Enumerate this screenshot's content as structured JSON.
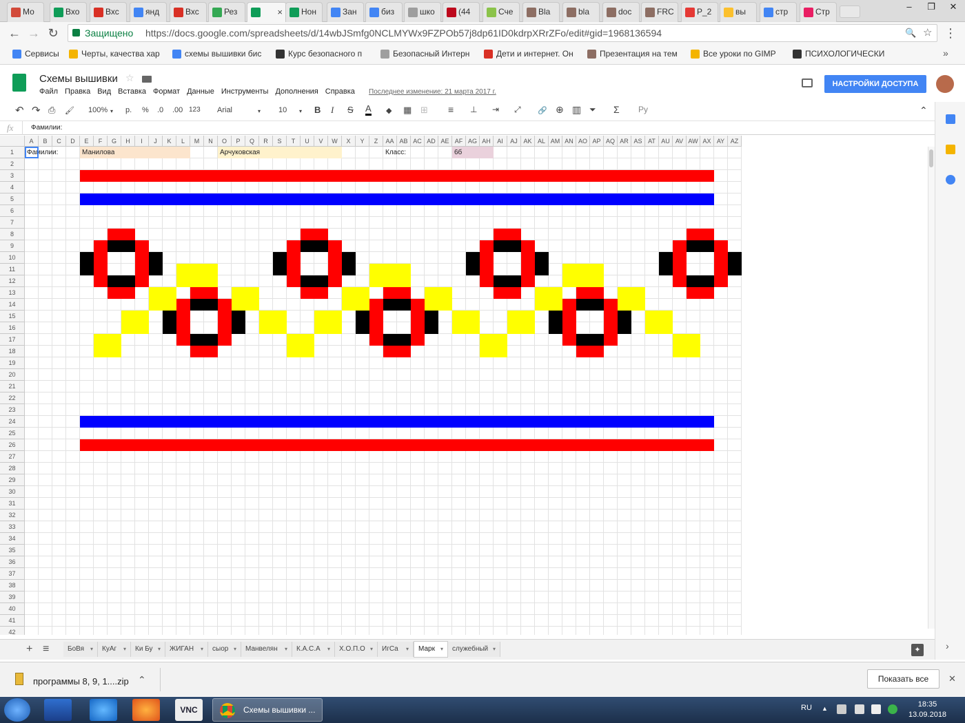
{
  "browser": {
    "tabs": [
      {
        "label": "Мо",
        "color": "#d24a3a"
      },
      {
        "label": "Вхо",
        "color": "#0f9d58"
      },
      {
        "label": "Вхс",
        "color": "#d93025"
      },
      {
        "label": "янд",
        "color": "#4285f4"
      },
      {
        "label": "Вхс",
        "color": "#d93025"
      },
      {
        "label": "Рез",
        "color": "#34a853"
      },
      {
        "label": "",
        "color": "#0f9d58",
        "active": true
      },
      {
        "label": "Нон",
        "color": "#0f9d58"
      },
      {
        "label": "Зан",
        "color": "#4285f4"
      },
      {
        "label": "биз",
        "color": "#4285f4"
      },
      {
        "label": "шко",
        "color": "#9e9e9e"
      },
      {
        "label": "(44",
        "color": "#bd081c"
      },
      {
        "label": "Сче",
        "color": "#8bc34a"
      },
      {
        "label": "Bla",
        "color": "#8d6e63"
      },
      {
        "label": "bla",
        "color": "#8d6e63"
      },
      {
        "label": "doc",
        "color": "#8d6e63"
      },
      {
        "label": "FRC",
        "color": "#8d6e63"
      },
      {
        "label": "P_2",
        "color": "#e53935"
      },
      {
        "label": "вы",
        "color": "#fbc02d"
      },
      {
        "label": "стр",
        "color": "#4285f4"
      },
      {
        "label": "Стр",
        "color": "#e91e63"
      }
    ],
    "close_glyph": "×",
    "win_controls": [
      "–",
      "❐",
      "✕"
    ],
    "nav": {
      "back": "←",
      "forward": "→",
      "reload": "↻",
      "menu": "⋮",
      "zoom": "🔍",
      "star": "☆"
    },
    "secure_label": "Защищено",
    "url": "https://docs.google.com/spreadsheets/d/14wbJSmfg0NCLMYWx9FZPOb57j8dp61ID0kdrpXRrZFo/edit#gid=1968136594",
    "bookmarks": [
      {
        "label": "Сервисы",
        "color": "#4285f4"
      },
      {
        "label": "Черты, качества хар",
        "color": "#f4b400"
      },
      {
        "label": "схемы вышивки бис",
        "color": "#4285f4"
      },
      {
        "label": "Курс безопасного п",
        "color": "#333333"
      },
      {
        "label": "Безопасный Интерн",
        "color": "#9e9e9e"
      },
      {
        "label": "Дети и интернет. Он",
        "color": "#d93025"
      },
      {
        "label": "Презентация на тем",
        "color": "#8d6e63"
      },
      {
        "label": "Все уроки по GIMP",
        "color": "#f4b400"
      },
      {
        "label": "ПСИХОЛОГИЧЕСКИ",
        "color": "#333333"
      }
    ],
    "bookmarks_more": "»"
  },
  "sheets": {
    "title": "Схемы вышивки",
    "star_glyph": "☆",
    "menus": [
      "Файл",
      "Правка",
      "Вид",
      "Вставка",
      "Формат",
      "Данные",
      "Инструменты",
      "Дополнения",
      "Справка"
    ],
    "last_edit": "Последнее изменение: 21 марта 2017 г.",
    "share_label": "НАСТРОЙКИ ДОСТУПА",
    "toolbar": {
      "undo": "↶",
      "redo": "↷",
      "print": "⎙",
      "paint": "🖌",
      "zoom": "100%",
      "currency": "р.",
      "percent": "%",
      "dec_less": ".0",
      "dec_more": ".00",
      "format_more": "123",
      "font": "Arial",
      "font_size": "10",
      "bold": "B",
      "italic": "I",
      "strike": "S",
      "text_color": "A",
      "fill": "◆",
      "borders": "▦",
      "merge": "⊞",
      "halign": "≡",
      "valign": "⊥",
      "wrap": "⇥",
      "rotate": "⤢",
      "link": "🔗",
      "comment": "⊕",
      "chart": "▥",
      "filter": "⏷",
      "functions": "Σ",
      "input": "Ру",
      "collapse": "⌃",
      "caret": "▾"
    },
    "formula_label": "fx",
    "formula_value": "Фамилии:",
    "columns": [
      "A",
      "B",
      "C",
      "D",
      "E",
      "F",
      "G",
      "H",
      "I",
      "J",
      "K",
      "L",
      "M",
      "N",
      "O",
      "P",
      "Q",
      "R",
      "S",
      "T",
      "U",
      "V",
      "W",
      "X",
      "Y",
      "Z",
      "AA",
      "AB",
      "AC",
      "AD",
      "AE",
      "AF",
      "AG",
      "AH",
      "AI",
      "AJ",
      "AK",
      "AL",
      "AM",
      "AN",
      "AO",
      "AP",
      "AQ",
      "AR",
      "AS",
      "AT",
      "AU",
      "AV",
      "AW",
      "AX",
      "AY",
      "AZ"
    ],
    "row_count": 42,
    "cells": {
      "a1": "Фамилии:",
      "e1": "Манилова",
      "o1": "Арчуковская",
      "aa1": "Класс:",
      "af1": "6б"
    },
    "colors": {
      "red": "#ff0000",
      "blue": "#0000ff",
      "black": "#000000",
      "yellow": "#ffff00",
      "e1_fill": "#fce5cd",
      "o1_fill": "#fff2cc",
      "af1_fill": "#ead1dc"
    },
    "sheet_tabs": [
      "БоВя",
      "КуАг",
      "Ки Бу",
      "ЖИГАН",
      "сыор",
      "Манвелян",
      "К.А.С.А",
      "Х.О.П.О",
      "ИгСа",
      "Марк",
      "служебный"
    ],
    "active_sheet": "Марк",
    "add_sheet": "+",
    "all_sheets": "≡",
    "explore": "✦"
  },
  "downloads": {
    "file": "программы 8, 9, 1....zip",
    "caret": "⌃",
    "show_all": "Показать все",
    "close": "✕"
  },
  "taskbar": {
    "chrome_label": "Схемы вышивки ...",
    "lang": "RU",
    "time": "18:35",
    "date": "13.09.2018",
    "tray_arrow": "▲"
  }
}
